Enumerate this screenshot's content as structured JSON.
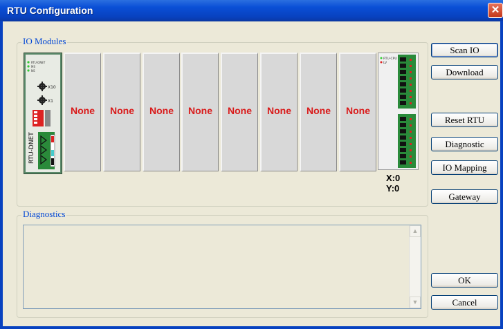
{
  "window": {
    "title": "RTU Configuration",
    "close_glyph": "✕"
  },
  "io_modules": {
    "label": "IO Modules",
    "rtu_label": "RTU-DNET",
    "rtu_indicators": [
      "RTU-DNET",
      "MS",
      "NS"
    ],
    "switch_labels": [
      "X10",
      "X1"
    ],
    "slots": [
      {
        "label": "None"
      },
      {
        "label": "None"
      },
      {
        "label": "None"
      },
      {
        "label": "None"
      },
      {
        "label": "None"
      },
      {
        "label": "None"
      },
      {
        "label": "None"
      },
      {
        "label": "None"
      }
    ],
    "terminal_indicators": [
      "RTU-CPU",
      "LV"
    ],
    "coord_x": "X:0",
    "coord_y": "Y:0"
  },
  "diagnostics": {
    "label": "Diagnostics",
    "text": ""
  },
  "buttons": {
    "scan_io": "Scan IO",
    "download": "Download",
    "reset_rtu": "Reset RTU",
    "diagnostic": "Diagnostic",
    "io_mapping": "IO Mapping",
    "gateway": "Gateway",
    "ok": "OK",
    "cancel": "Cancel"
  },
  "colors": {
    "title_bar": "#0a4fd6",
    "slot_none_text": "#d91a1a",
    "group_label": "#0046d5",
    "rtu_green": "#2a8a3a"
  }
}
